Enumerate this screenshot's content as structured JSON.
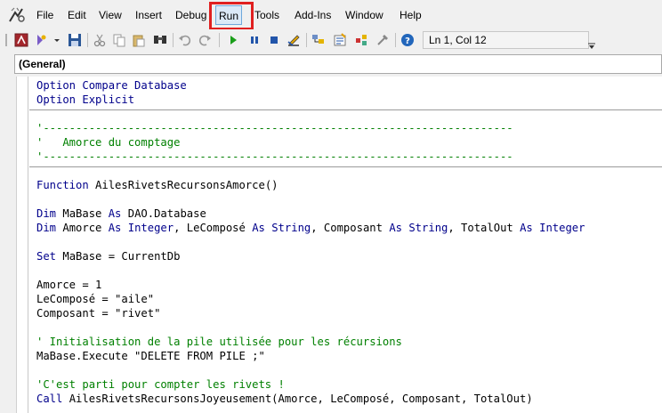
{
  "menubar": {
    "items": [
      "File",
      "Edit",
      "View",
      "Insert",
      "Debug",
      "Run",
      "Tools",
      "Add-Ins",
      "Window",
      "Help"
    ],
    "active": "Run"
  },
  "toolbar": {
    "cursor_position": "Ln 1, Col 12",
    "icons": [
      "access-view-icon",
      "insert-module-icon",
      "save-icon",
      "cut-icon",
      "copy-icon",
      "paste-icon",
      "find-icon",
      "undo-icon",
      "redo-icon",
      "run-icon",
      "break-icon",
      "reset-icon",
      "design-mode-icon",
      "project-explorer-icon",
      "properties-icon",
      "object-browser-icon",
      "toolbox-icon",
      "help-icon"
    ]
  },
  "object_dropdown": {
    "selected": "(General)"
  },
  "code": {
    "lines": [
      [
        {
          "t": "Option Compare Database",
          "c": "kw"
        }
      ],
      [
        {
          "t": "Option Explicit",
          "c": "kw"
        }
      ],
      [
        {
          "t": "",
          "c": ""
        }
      ],
      [
        {
          "t": "'------------------------------------------------------------------------",
          "c": "cm"
        }
      ],
      [
        {
          "t": "'   Amorce du comptage",
          "c": "cm"
        }
      ],
      [
        {
          "t": "'------------------------------------------------------------------------",
          "c": "cm"
        }
      ],
      [
        {
          "t": "",
          "c": ""
        }
      ],
      [
        {
          "t": "Function",
          "c": "kw"
        },
        {
          "t": " AilesRivetsRecursonsAmorce()",
          "c": ""
        }
      ],
      [
        {
          "t": "",
          "c": ""
        }
      ],
      [
        {
          "t": "Dim",
          "c": "kw"
        },
        {
          "t": " MaBase ",
          "c": ""
        },
        {
          "t": "As",
          "c": "kw"
        },
        {
          "t": " DAO.Database",
          "c": ""
        }
      ],
      [
        {
          "t": "Dim",
          "c": "kw"
        },
        {
          "t": " Amorce ",
          "c": ""
        },
        {
          "t": "As",
          "c": "kw"
        },
        {
          "t": " ",
          "c": ""
        },
        {
          "t": "Integer",
          "c": "kw"
        },
        {
          "t": ", LeComposé ",
          "c": ""
        },
        {
          "t": "As",
          "c": "kw"
        },
        {
          "t": " ",
          "c": ""
        },
        {
          "t": "String",
          "c": "kw"
        },
        {
          "t": ", Composant ",
          "c": ""
        },
        {
          "t": "As",
          "c": "kw"
        },
        {
          "t": " ",
          "c": ""
        },
        {
          "t": "String",
          "c": "kw"
        },
        {
          "t": ", TotalOut ",
          "c": ""
        },
        {
          "t": "As",
          "c": "kw"
        },
        {
          "t": " ",
          "c": ""
        },
        {
          "t": "Integer",
          "c": "kw"
        }
      ],
      [
        {
          "t": "",
          "c": ""
        }
      ],
      [
        {
          "t": "Set",
          "c": "kw"
        },
        {
          "t": " MaBase = CurrentDb",
          "c": ""
        }
      ],
      [
        {
          "t": "",
          "c": ""
        }
      ],
      [
        {
          "t": "Amorce = 1",
          "c": ""
        }
      ],
      [
        {
          "t": "LeComposé = \"aile\"",
          "c": ""
        }
      ],
      [
        {
          "t": "Composant = \"rivet\"",
          "c": ""
        }
      ],
      [
        {
          "t": "",
          "c": ""
        }
      ],
      [
        {
          "t": "' Initialisation de la pile utilisée pour les récursions",
          "c": "cm"
        }
      ],
      [
        {
          "t": "MaBase.Execute \"DELETE FROM PILE ;\"",
          "c": ""
        }
      ],
      [
        {
          "t": "",
          "c": ""
        }
      ],
      [
        {
          "t": "'C'est parti pour compter les rivets !",
          "c": "cm"
        }
      ],
      [
        {
          "t": "Call",
          "c": "kw"
        },
        {
          "t": " AilesRivetsRecursonsJoyeusement(Amorce, LeComposé, Composant, TotalOut)",
          "c": ""
        }
      ]
    ]
  }
}
